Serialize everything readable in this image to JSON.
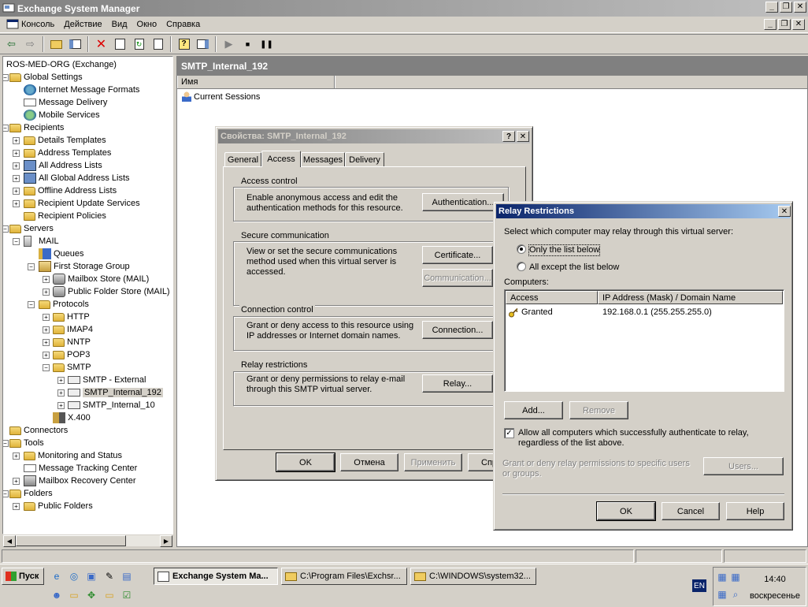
{
  "app": {
    "title": "Exchange System Manager",
    "colors": {
      "title_inactive": "#808080",
      "title_active": "#0a246a",
      "face": "#d4d0c8"
    }
  },
  "menu": [
    "Консоль",
    "Действие",
    "Вид",
    "Окно",
    "Справка"
  ],
  "toolbar": {
    "icons": [
      "back-icon",
      "forward-icon",
      "up-folder-icon",
      "show-hide-tree-icon",
      "delete-icon",
      "properties-icon",
      "refresh-icon",
      "export-list-icon",
      "help-icon",
      "show-hide-pane-icon",
      "start-icon",
      "stop-icon",
      "pause-icon"
    ]
  },
  "tree": {
    "root": "ROS-MED-ORG (Exchange)",
    "global_settings": "Global Settings",
    "internet_message_formats": "Internet Message Formats",
    "message_delivery": "Message Delivery",
    "mobile_services": "Mobile Services",
    "recipients": "Recipients",
    "details_templates": "Details Templates",
    "address_templates": "Address Templates",
    "all_address_lists": "All Address Lists",
    "all_global_address_lists": "All Global Address Lists",
    "offline_address_lists": "Offline Address Lists",
    "recipient_update_services": "Recipient Update Services",
    "recipient_policies": "Recipient Policies",
    "servers": "Servers",
    "mail": "MAIL",
    "queues": "Queues",
    "first_storage_group": "First Storage Group",
    "mailbox_store": "Mailbox Store (MAIL)",
    "public_folder_store": "Public Folder Store (MAIL)",
    "protocols": "Protocols",
    "http": "HTTP",
    "imap4": "IMAP4",
    "nntp": "NNTP",
    "pop3": "POP3",
    "smtp": "SMTP",
    "smtp_external": "SMTP - External",
    "smtp_internal_192": "SMTP_Internal_192",
    "smtp_internal_10": "SMTP_Internal_10",
    "x400": "X.400",
    "connectors": "Connectors",
    "tools": "Tools",
    "monitoring_and_status": "Monitoring and Status",
    "message_tracking_center": "Message Tracking Center",
    "mailbox_recovery_center": "Mailbox Recovery Center",
    "folders": "Folders",
    "public_folders": "Public Folders"
  },
  "right_pane": {
    "header": "SMTP_Internal_192",
    "column": "Имя",
    "item": "Current Sessions"
  },
  "props_dialog": {
    "title": "Свойства: SMTP_Internal_192",
    "help_btn": "?",
    "close_btn": "✕",
    "tabs": [
      "General",
      "Access",
      "Messages",
      "Delivery"
    ],
    "access_control": {
      "label": "Access control",
      "text": "Enable anonymous access and edit the authentication methods for this resource.",
      "button": "Authentication..."
    },
    "secure_comm": {
      "label": "Secure communication",
      "text": "View or set the secure communications method used when this virtual server is accessed.",
      "button1": "Certificate...",
      "button2": "Communication..."
    },
    "connection_control": {
      "label": "Connection control",
      "text": "Grant or deny access to this resource using IP addresses or Internet domain names.",
      "button": "Connection..."
    },
    "relay": {
      "label": "Relay restrictions",
      "text": "Grant or deny permissions to relay e-mail through this SMTP virtual server.",
      "button": "Relay..."
    },
    "ok": "OK",
    "cancel": "Отмена",
    "apply": "Применить",
    "help": "Спр"
  },
  "relay_dialog": {
    "title": "Relay Restrictions",
    "close_btn": "✕",
    "prompt": "Select which computer may relay through this virtual server:",
    "radio_only": "Only the list below",
    "radio_except": "All except the list below",
    "computers_label": "Computers:",
    "col_access": "Access",
    "col_ip": "IP Address (Mask) / Domain Name",
    "rows": [
      {
        "access": "Granted",
        "ip": "192.168.0.1 (255.255.255.0)"
      }
    ],
    "add": "Add...",
    "remove": "Remove",
    "allow_auth": "Allow all computers which successfully authenticate to relay, regardless of the list above.",
    "grant_text": "Grant or deny relay permissions to specific users or groups.",
    "users": "Users...",
    "ok": "OK",
    "cancel": "Cancel",
    "help": "Help"
  },
  "taskbar": {
    "start": "Пуск",
    "tasks": [
      "Exchange System Ma...",
      "C:\\Program Files\\Exchsr...",
      "C:\\WINDOWS\\system32..."
    ],
    "lang": "EN",
    "time": "14:40",
    "day": "воскресенье"
  }
}
